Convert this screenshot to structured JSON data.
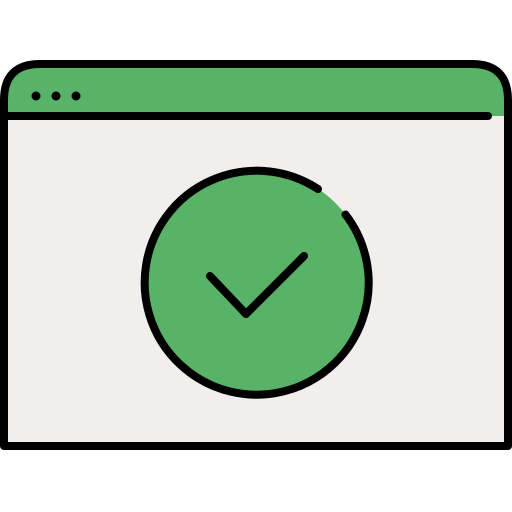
{
  "icon": {
    "name": "browser-window-checkmark-icon",
    "colors": {
      "accent": "#58B368",
      "window_body": "#F2EEEE",
      "outline": "#000000",
      "background": "#FFFFFF"
    },
    "window": {
      "titlebar_dots": 3
    },
    "badge": {
      "symbol": "checkmark"
    }
  }
}
